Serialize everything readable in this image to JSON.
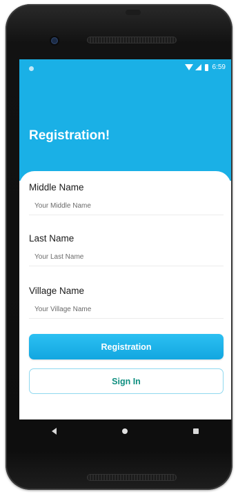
{
  "status_bar": {
    "time": "6:59"
  },
  "header": {
    "title": "Registration!"
  },
  "form": {
    "fields": [
      {
        "label": "Middle Name",
        "placeholder": "Your Middle Name"
      },
      {
        "label": "Last Name",
        "placeholder": "Your Last Name"
      },
      {
        "label": "Village Name",
        "placeholder": "Your Village Name"
      }
    ],
    "primary_button": "Registration",
    "secondary_button": "Sign In"
  },
  "colors": {
    "accent": "#1ab0e6",
    "button_secondary_text": "#0f8f80"
  },
  "icons": [
    "wifi-icon",
    "signal-icon",
    "battery-icon",
    "back-icon",
    "home-icon",
    "recents-icon"
  ]
}
